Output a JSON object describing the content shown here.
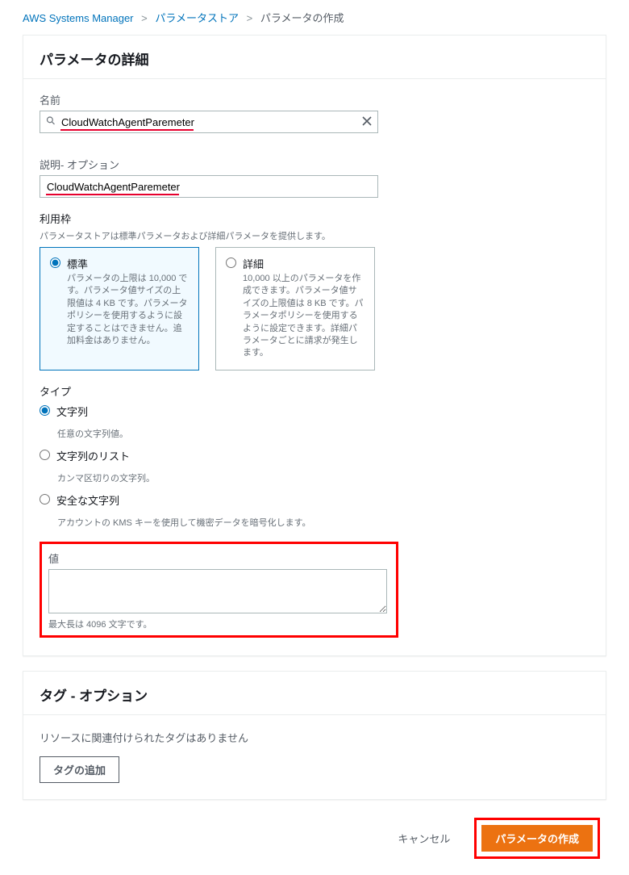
{
  "breadcrumb": {
    "root": "AWS Systems Manager",
    "store": "パラメータストア",
    "current": "パラメータの作成"
  },
  "panel": {
    "title": "パラメータの詳細"
  },
  "name": {
    "label": "名前",
    "value": "CloudWatchAgentParemeter"
  },
  "desc": {
    "label": "説明- オプション",
    "value": "CloudWatchAgentParemeter"
  },
  "tier": {
    "label": "利用枠",
    "hint": "パラメータストアは標準パラメータおよび詳細パラメータを提供します。",
    "std_title": "標準",
    "std_desc": "パラメータの上限は 10,000 です。パラメータ値サイズの上限値は 4 KB です。パラメータポリシーを使用するように設定することはできません。追加料金はありません。",
    "adv_title": "詳細",
    "adv_desc": "10,000 以上のパラメータを作成できます。パラメータ値サイズの上限値は 8 KB です。パラメータポリシーを使用するように設定できます。詳細パラメータごとに請求が発生します。"
  },
  "type": {
    "label": "タイプ",
    "string_label": "文字列",
    "string_desc": "任意の文字列値。",
    "list_label": "文字列のリスト",
    "list_desc": "カンマ区切りの文字列。",
    "secure_label": "安全な文字列",
    "secure_desc": "アカウントの KMS キーを使用して機密データを暗号化します。"
  },
  "value": {
    "label": "値",
    "hint": "最大長は 4096 文字です。",
    "content": ""
  },
  "tags": {
    "title": "タグ - オプション",
    "empty": "リソースに関連付けられたタグはありません",
    "add": "タグの追加"
  },
  "footer": {
    "cancel": "キャンセル",
    "submit": "パラメータの作成"
  }
}
